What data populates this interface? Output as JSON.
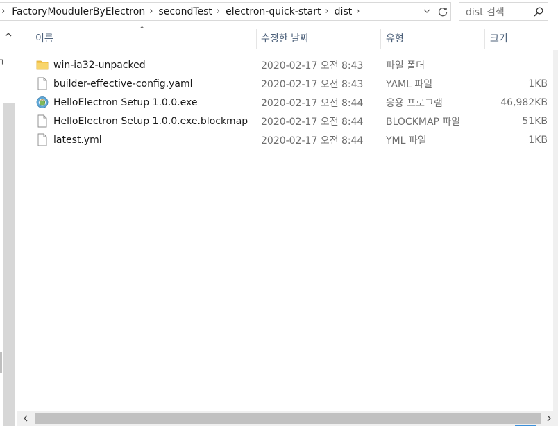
{
  "address": {
    "breadcrumbs": [
      "FactoryMoudulerByElectron",
      "secondTest",
      "electron-quick-start",
      "dist"
    ],
    "search_placeholder": "dist 검색"
  },
  "columns": {
    "name": "이름",
    "modified": "수정한 날짜",
    "type": "유형",
    "size": "크기"
  },
  "files": [
    {
      "name": "win-ia32-unpacked",
      "modified": "2020-02-17 오전 8:43",
      "type": "파일 폴더",
      "size": "",
      "icon": "folder-icon"
    },
    {
      "name": "builder-effective-config.yaml",
      "modified": "2020-02-17 오전 8:43",
      "type": "YAML 파일",
      "size": "1KB",
      "icon": "document-icon"
    },
    {
      "name": "HelloElectron Setup 1.0.0.exe",
      "modified": "2020-02-17 오전 8:44",
      "type": "응용 프로그램",
      "size": "46,982KB",
      "icon": "installer-icon"
    },
    {
      "name": "HelloElectron Setup 1.0.0.exe.blockmap",
      "modified": "2020-02-17 오전 8:44",
      "type": "BLOCKMAP 파일",
      "size": "51KB",
      "icon": "document-icon"
    },
    {
      "name": "latest.yml",
      "modified": "2020-02-17 오전 8:44",
      "type": "YML 파일",
      "size": "1KB",
      "icon": "document-icon"
    }
  ],
  "icons": {
    "breadcrumb_separator": "chevron-right-icon",
    "dropdown": "chevron-down-icon",
    "refresh": "refresh-icon",
    "search": "search-icon",
    "sort": "sort-ascending-icon"
  },
  "colors": {
    "header_text": "#4c607a",
    "folder": "#f4c44e",
    "accent": "#3b8fd9"
  }
}
